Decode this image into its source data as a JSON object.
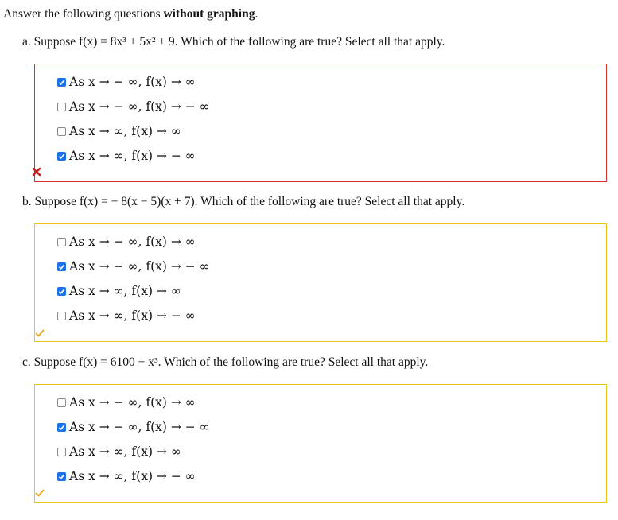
{
  "instructions": {
    "prefix": "Answer the following questions ",
    "bold": "without graphing",
    "suffix": "."
  },
  "questions": [
    {
      "text": "a. Suppose f(x) = 8x³ + 5x² + 9. Which of the following are true? Select all that apply.",
      "status": "incorrect",
      "status_icon": "cross-icon",
      "options": [
        {
          "label": "As x → − ∞, f(x) → ∞",
          "checked": true
        },
        {
          "label": "As x → − ∞, f(x) → − ∞",
          "checked": false
        },
        {
          "label": "As x → ∞, f(x) → ∞",
          "checked": false
        },
        {
          "label": "As x → ∞, f(x) → − ∞",
          "checked": true
        }
      ]
    },
    {
      "text": "b. Suppose f(x) = − 8(x − 5)(x + 7). Which of the following are true? Select all that apply.",
      "status": "correct",
      "status_icon": "checkmark-icon",
      "options": [
        {
          "label": "As x → − ∞, f(x) → ∞",
          "checked": false
        },
        {
          "label": "As x → − ∞, f(x) → − ∞",
          "checked": true
        },
        {
          "label": "As x → ∞, f(x) → ∞",
          "checked": true
        },
        {
          "label": "As x → ∞, f(x) → − ∞",
          "checked": false
        }
      ]
    },
    {
      "text": "c. Suppose f(x) = 6100 − x³. Which of the following are true? Select all that apply.",
      "status": "correct",
      "status_icon": "checkmark-icon",
      "options": [
        {
          "label": "As x → − ∞, f(x) → ∞",
          "checked": false
        },
        {
          "label": "As x → − ∞, f(x) → − ∞",
          "checked": true
        },
        {
          "label": "As x → ∞, f(x) → ∞",
          "checked": false
        },
        {
          "label": "As x → ∞, f(x) → − ∞",
          "checked": true
        }
      ]
    }
  ],
  "colors": {
    "incorrect_border": "#d92e2e",
    "correct_border": "#e8c516",
    "checkbox_checked": "#1a73e8",
    "cross_icon": "#cc1f1f",
    "check_icon": "#e6a817"
  }
}
